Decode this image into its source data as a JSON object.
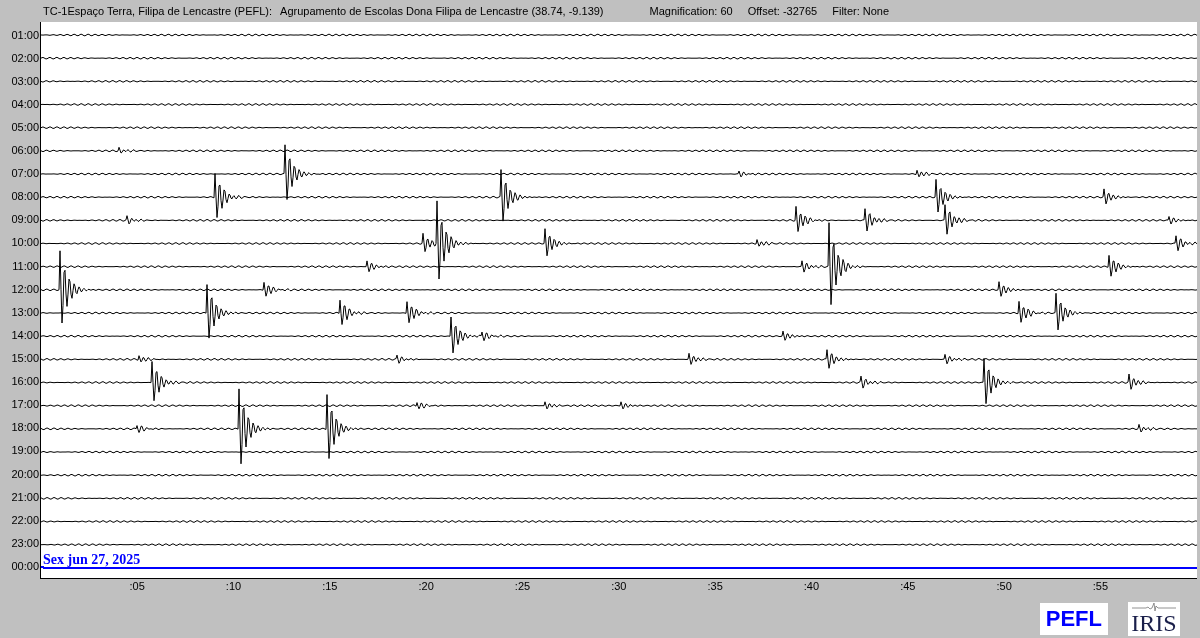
{
  "header": {
    "station": "TC-1Espaço Terra, Filipa de Lencastre (PEFL):",
    "location": "Agrupamento de Escolas Dona Filipa de Lencastre (38.74, -9.139)",
    "magnification": "Magnification: 60",
    "offset": "Offset: -32765",
    "filter": "Filter: None"
  },
  "rows": [
    {
      "label": "01:00",
      "color": "#000000"
    },
    {
      "label": "02:00",
      "color": "#000000"
    },
    {
      "label": "03:00",
      "color": "#000000"
    },
    {
      "label": "04:00",
      "color": "#000000"
    },
    {
      "label": "05:00",
      "color": "#000000"
    },
    {
      "label": "06:00",
      "color": "#000000"
    },
    {
      "label": "07:00",
      "color": "#000000"
    },
    {
      "label": "08:00",
      "color": "#000000"
    },
    {
      "label": "09:00",
      "color": "#000000"
    },
    {
      "label": "10:00",
      "color": "#000000"
    },
    {
      "label": "11:00",
      "color": "#000000"
    },
    {
      "label": "12:00",
      "color": "#000000"
    },
    {
      "label": "13:00",
      "color": "#000000"
    },
    {
      "label": "14:00",
      "color": "#000000"
    },
    {
      "label": "15:00",
      "color": "#000000"
    },
    {
      "label": "16:00",
      "color": "#000000"
    },
    {
      "label": "17:00",
      "color": "#000000"
    },
    {
      "label": "18:00",
      "color": "#000000"
    },
    {
      "label": "19:00",
      "color": "#000000"
    },
    {
      "label": "20:00",
      "color": "#000000"
    },
    {
      "label": "21:00",
      "color": "#000000"
    },
    {
      "label": "22:00",
      "color": "#000000"
    },
    {
      "label": "23:00",
      "color": "#000000"
    },
    {
      "label": "00:00",
      "color": "#0000ff"
    }
  ],
  "date_label": "Sex jun 27, 2025",
  "x_ticks": [
    ":05",
    ":10",
    ":15",
    ":20",
    ":25",
    ":30",
    ":35",
    ":40",
    ":45",
    ":50",
    ":55"
  ],
  "logos": {
    "station": "PEFL",
    "network": "IRIS"
  }
}
